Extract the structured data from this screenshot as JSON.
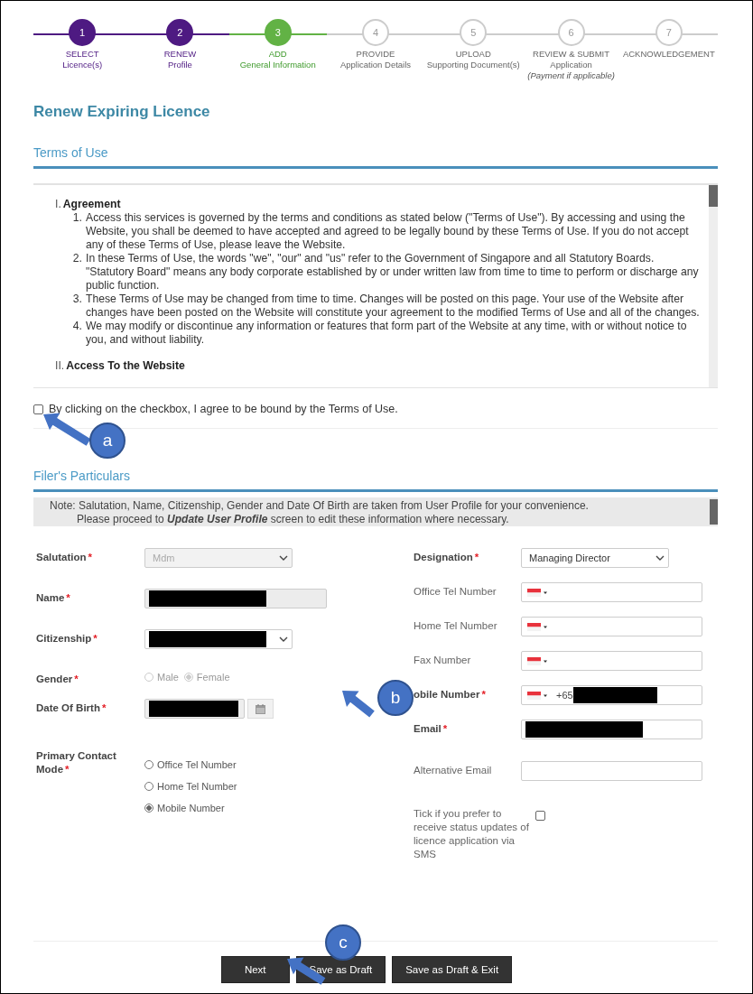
{
  "steps": [
    {
      "number": "1",
      "title": "SELECT",
      "subtitle": "Licence(s)",
      "completed": true,
      "selected": false
    },
    {
      "number": "2",
      "title": "RENEW",
      "subtitle": "Profile",
      "completed": true,
      "selected": false
    },
    {
      "number": "3",
      "title": "ADD",
      "subtitle": "General Information",
      "completed": false,
      "selected": true
    },
    {
      "number": "4",
      "title": "PROVIDE",
      "subtitle": "Application Details",
      "completed": false,
      "selected": false
    },
    {
      "number": "5",
      "title": "UPLOAD",
      "subtitle": "Supporting Document(s)",
      "completed": false,
      "selected": false
    },
    {
      "number": "6",
      "title": "REVIEW & SUBMIT",
      "subtitle": "Application",
      "note": "(Payment if applicable)",
      "completed": false,
      "selected": false
    },
    {
      "number": "7",
      "title": "ACKNOWLEDGEMENT",
      "completed": false,
      "selected": false
    }
  ],
  "page_title": "Renew Expiring Licence",
  "terms": {
    "heading": "Terms of Use",
    "sections": [
      {
        "numeral": "I.",
        "heading": "Agreement",
        "items": [
          {
            "number": "1.",
            "text": "Access this services is governed by the terms and conditions as stated below (\"Terms of Use\"). By accessing and using the Website, you shall be deemed to have accepted and agreed to be legally bound by these Terms of Use. If you do not accept any of these Terms of Use, please leave the Website."
          },
          {
            "number": "2.",
            "text": "In these Terms of Use, the words \"we\", \"our\" and \"us\" refer to the Government of Singapore and all Statutory Boards. \"Statutory Board\" means any body corporate established by or under written law from time to time to perform or discharge any public function."
          },
          {
            "number": "3.",
            "text": "These Terms of Use may be changed from time to time. Changes will be posted on this page. Your use of the Website after changes have been posted on the Website will constitute your agreement to the modified Terms of Use and all of the changes."
          },
          {
            "number": "4.",
            "text": "We may modify or discontinue any information or features that form part of the Website at any time, with or without notice to you, and without liability."
          }
        ]
      },
      {
        "numeral": "II.",
        "heading": "Access To the Website"
      }
    ],
    "agree": {
      "label": "By clicking on the checkbox, I agree to be bound by the Terms of Use.",
      "checked": false
    }
  },
  "particulars": {
    "heading": "Filer's Particulars",
    "note": [
      "Note: Salutation, Name, Citizenship, Gender and Date Of Birth are taken from User Profile for your convenience.",
      "Please proceed to **Update User Profile** screen to edit these information where necessary."
    ],
    "left_fields": [
      {
        "kind": "select",
        "label": "Salutation",
        "mark": "*",
        "value": "Mdm",
        "disabled": true
      },
      {
        "kind": "text",
        "label": "Name",
        "mark": "*",
        "redacted": true,
        "disabled": true
      },
      {
        "kind": "select",
        "label": "Citizenship",
        "mark": "*",
        "redacted": true
      },
      {
        "kind": "radio-row",
        "label": "Gender",
        "mark": "*",
        "disabled": true,
        "options": [
          {
            "label": "Male",
            "selected": false
          },
          {
            "label": "Female",
            "selected": true
          }
        ]
      },
      {
        "kind": "date",
        "label": "Date Of Birth",
        "mark": "*",
        "redacted": true
      },
      {
        "kind": "radio-list",
        "label": "Primary Contact Mode",
        "mark": "*",
        "options": [
          {
            "label": "Office Tel Number",
            "selected": false
          },
          {
            "label": "Home Tel Number",
            "selected": false
          },
          {
            "label": "Mobile Number",
            "selected": true
          }
        ]
      }
    ],
    "right_fields": [
      {
        "kind": "select",
        "label": "Designation",
        "mark": "*",
        "value": "Managing Director"
      },
      {
        "kind": "phone",
        "label": "Office Tel Number"
      },
      {
        "kind": "phone",
        "label": "Home Tel Number"
      },
      {
        "kind": "phone",
        "label": "Fax Number"
      },
      {
        "kind": "phone",
        "label": "obile Number",
        "mark": "*",
        "value": "+65",
        "redacted": true
      },
      {
        "kind": "text",
        "label": "Email",
        "mark": "*",
        "redacted": true
      },
      {
        "kind": "text",
        "label": "Alternative Email"
      },
      {
        "kind": "checkbox",
        "label": "Tick if you prefer to receive status updates of licence application via SMS",
        "checked": false
      }
    ]
  },
  "buttons": [
    {
      "label": "Next"
    },
    {
      "label": "Save as Draft"
    },
    {
      "label": "Save as Draft & Exit"
    }
  ],
  "callouts": [
    {
      "label": "a"
    },
    {
      "label": "b"
    },
    {
      "label": "c"
    }
  ]
}
